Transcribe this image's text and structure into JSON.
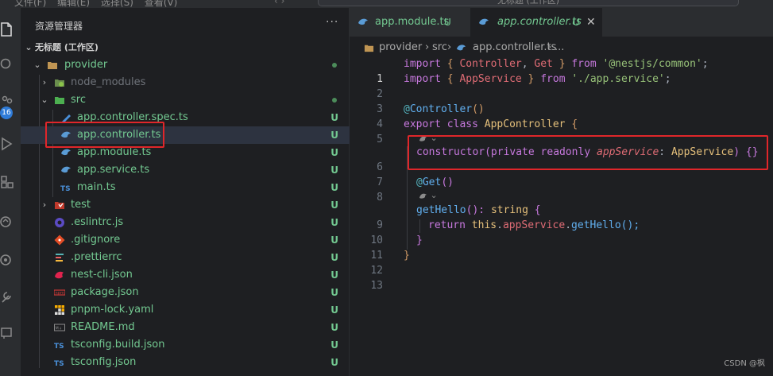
{
  "menubar": {
    "menus": [
      "文件(F)",
      "编辑(E)",
      "选择(S)",
      "查看(V)"
    ],
    "nav_arrows": "‹  ›",
    "command_center": "无标题 (工作区)"
  },
  "activity": {
    "source_control_badge": "16"
  },
  "explorer": {
    "title": "资源管理器",
    "more": "···",
    "workspace": "无标题 (工作区)",
    "items": [
      {
        "label": "provider",
        "git": ""
      },
      {
        "label": "node_modules",
        "git": ""
      },
      {
        "label": "src",
        "git": ""
      },
      {
        "label": "app.controller.spec.ts",
        "git": "U"
      },
      {
        "label": "app.controller.ts",
        "git": "U"
      },
      {
        "label": "app.module.ts",
        "git": "U"
      },
      {
        "label": "app.service.ts",
        "git": "U"
      },
      {
        "label": "main.ts",
        "git": "U"
      },
      {
        "label": "test",
        "git": "U"
      },
      {
        "label": ".eslintrc.js",
        "git": "U"
      },
      {
        "label": ".gitignore",
        "git": "U"
      },
      {
        "label": ".prettierrc",
        "git": "U"
      },
      {
        "label": "nest-cli.json",
        "git": "U"
      },
      {
        "label": "package.json",
        "git": "U"
      },
      {
        "label": "pnpm-lock.yaml",
        "git": "U"
      },
      {
        "label": "README.md",
        "git": "U"
      },
      {
        "label": "tsconfig.build.json",
        "git": "U"
      },
      {
        "label": "tsconfig.json",
        "git": "U"
      }
    ]
  },
  "tabs": [
    {
      "label": "app.module.ts",
      "status": "U"
    },
    {
      "label": "app.controller.ts",
      "status": "U",
      "close": "✕"
    }
  ],
  "breadcrumb": [
    "provider",
    "›",
    "src",
    "›",
    "app.controller.ts",
    "›",
    "..."
  ],
  "code": {
    "line_numbers": [
      "1",
      "2",
      "3",
      "4",
      "5",
      "6",
      "7",
      "8",
      "9",
      "10",
      "11",
      "12",
      "13"
    ],
    "l1": {
      "a": "import",
      "b": " { ",
      "c": "Controller",
      "d": ", ",
      "e": "Get",
      "f": " } ",
      "g": "from",
      "h": " ",
      "i": "'@nestjs/common'",
      "j": ";"
    },
    "l2": {
      "a": "import",
      "b": " { ",
      "c": "AppService",
      "f": " } ",
      "g": "from",
      "h": " ",
      "i": "'./app.service'",
      "j": ";"
    },
    "l4": {
      "a": "@",
      "b": "Controller",
      "c": "()"
    },
    "l5": {
      "a": "export",
      "b": " ",
      "c": "class",
      "d": " ",
      "e": "AppController",
      "f": " {"
    },
    "l6": {
      "a": "constructor",
      "b": "(",
      "c": "private",
      "d": " ",
      "e": "readonly",
      "f": " ",
      "g": "appService",
      "h": ": ",
      "i": "AppService",
      "j": ") ",
      "k": "{}"
    },
    "l7": {
      "a": "@",
      "b": "Get",
      "c": "()"
    },
    "l9": {
      "a": "getHello",
      "b": "(): ",
      "c": "string",
      "d": " {"
    },
    "l10": {
      "a": "return",
      "b": " ",
      "c": "this",
      "d": ".",
      "e": "appService",
      "f": ".",
      "g": "getHello",
      "h": "();"
    },
    "l11": {
      "a": "}"
    },
    "l12": {
      "a": "}"
    }
  },
  "watermark": "CSDN @枫"
}
